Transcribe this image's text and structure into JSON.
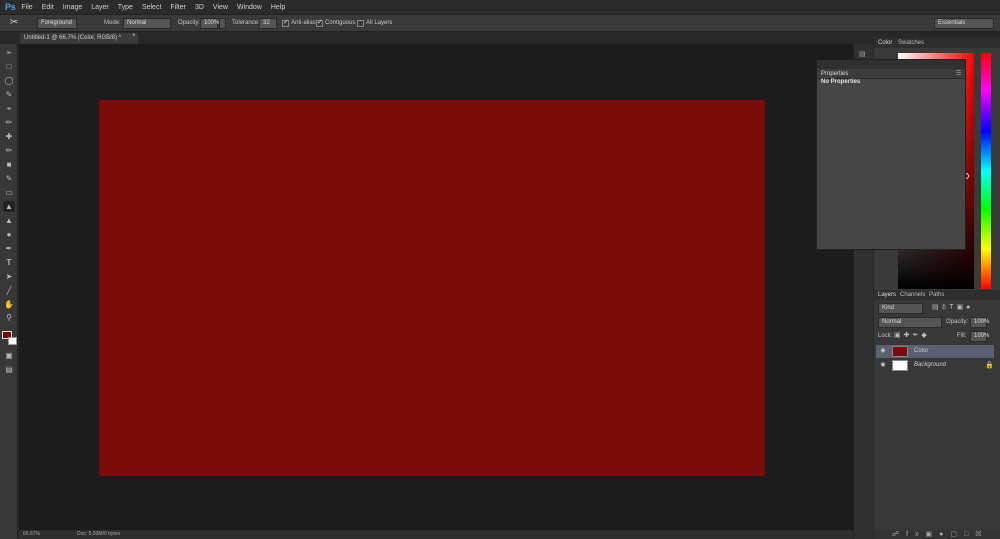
{
  "app": {
    "logo": "Ps"
  },
  "menu": [
    "File",
    "Edit",
    "Image",
    "Layer",
    "Type",
    "Select",
    "Filter",
    "3D",
    "View",
    "Window",
    "Help"
  ],
  "options": {
    "fill_source": "Foreground",
    "mode_label": "Mode:",
    "mode_value": "Normal",
    "opacity_label": "Opacity:",
    "opacity_value": "100%",
    "tolerance_label": "Tolerance:",
    "tolerance_value": "32",
    "antialias_label": "Anti-alias",
    "contiguous_label": "Contiguous",
    "all_layers_label": "All Layers",
    "workspace": "Essentials"
  },
  "document": {
    "tab_title": "Untitled-1 @ 66.7% (Color, RGB/8) *",
    "fill_color": "#7a0b09"
  },
  "status": {
    "zoom": "66.67%",
    "doc_info": "Doc: 5.93M/0 bytes"
  },
  "color_panel": {
    "tabs": [
      "Color",
      "Swatches"
    ]
  },
  "properties_panel": {
    "title": "Properties",
    "empty_text": "No Properties"
  },
  "layers_panel": {
    "tabs": [
      "Layers",
      "Channels",
      "Paths"
    ],
    "filter_kind": "Kind",
    "blend_mode": "Normal",
    "opacity_label": "Opacity:",
    "opacity_value": "100%",
    "lock_label": "Lock:",
    "fill_label": "Fill:",
    "fill_value": "100%",
    "layers": [
      {
        "name": "Color",
        "thumb_color": "#7a0b09",
        "selected": true
      },
      {
        "name": "Background",
        "thumb_color": "#ffffff",
        "selected": false
      }
    ]
  },
  "colors": {
    "accent_selected_row": "#5a6170",
    "foreground": "#7a0b09",
    "background": "#ffffff"
  },
  "tools": [
    "move-icon",
    "marquee-icon",
    "lasso-icon",
    "quick-select-icon",
    "crop-icon",
    "eyedropper-icon",
    "healing-icon",
    "brush-icon",
    "clone-stamp-icon",
    "history-brush-icon",
    "eraser-icon",
    "paint-bucket-icon",
    "blur-icon",
    "dodge-icon",
    "pen-icon",
    "type-icon",
    "path-select-icon",
    "line-icon",
    "hand-icon",
    "zoom-icon"
  ]
}
